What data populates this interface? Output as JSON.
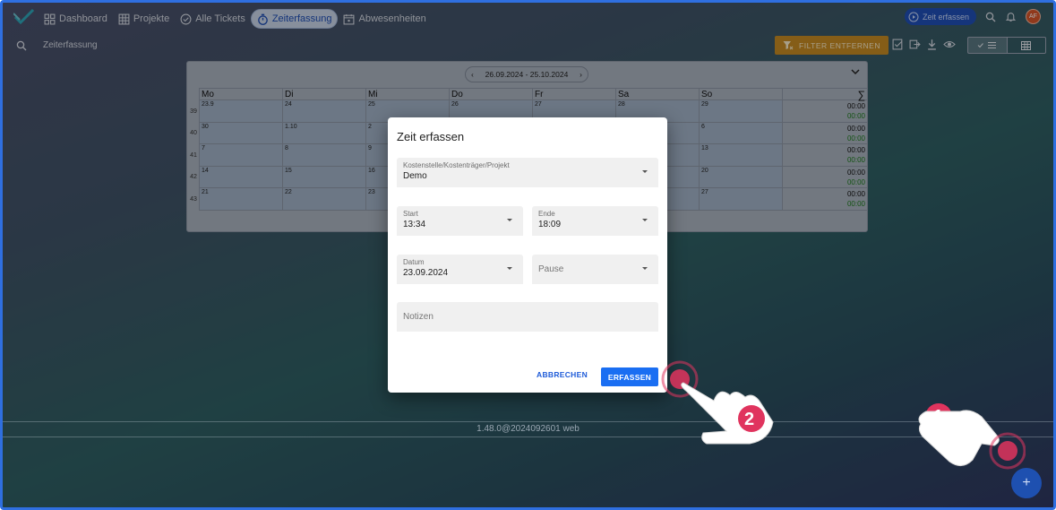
{
  "nav": {
    "items": [
      {
        "label": "Dashboard",
        "icon": "dashboard-icon"
      },
      {
        "label": "Projekte",
        "icon": "grid-icon"
      },
      {
        "label": "Alle Tickets",
        "icon": "check-circle-icon"
      },
      {
        "label": "Zeiterfassung",
        "icon": "stopwatch-icon",
        "active": true
      },
      {
        "label": "Abwesenheiten",
        "icon": "calendar-icon"
      }
    ]
  },
  "topbar": {
    "zeit_button": "Zeit erfassen",
    "avatar": "AF"
  },
  "subbar": {
    "title": "Zeiterfassung",
    "filter_button": "FILTER ENTFERNEN"
  },
  "calendar": {
    "range": "26.09.2024 - 25.10.2024",
    "days": [
      "Mo",
      "Di",
      "Mi",
      "Do",
      "Fr",
      "Sa",
      "So"
    ],
    "sum_symbol": "∑",
    "weeks": [
      {
        "week": "39",
        "dates": [
          "23.9",
          "24",
          "25",
          "26",
          "27",
          "28",
          "29"
        ],
        "sum1": "00:00",
        "sum2": "00:00"
      },
      {
        "week": "40",
        "dates": [
          "30",
          "1.10",
          "2",
          "",
          "",
          "",
          "6"
        ],
        "sum1": "00:00",
        "sum2": "00:00"
      },
      {
        "week": "41",
        "dates": [
          "7",
          "8",
          "9",
          "",
          "",
          "",
          "13"
        ],
        "sum1": "00:00",
        "sum2": "00:00"
      },
      {
        "week": "42",
        "dates": [
          "14",
          "15",
          "16",
          "",
          "",
          "",
          "20"
        ],
        "sum1": "00:00",
        "sum2": "00:00"
      },
      {
        "week": "43",
        "dates": [
          "21",
          "22",
          "23",
          "",
          "",
          "",
          "27"
        ],
        "sum1": "00:00",
        "sum2": "00:00"
      }
    ]
  },
  "footer": {
    "version": "1.48.0@2024092601 web"
  },
  "fab": {
    "label": "+"
  },
  "dialog": {
    "title": "Zeit erfassen",
    "kostenstelle": {
      "label": "Kostenstelle/Kostenträger/Projekt",
      "value": "Demo"
    },
    "start": {
      "label": "Start",
      "value": "13:34"
    },
    "ende": {
      "label": "Ende",
      "value": "18:09"
    },
    "datum": {
      "label": "Datum",
      "value": "23.09.2024"
    },
    "pause": {
      "placeholder": "Pause"
    },
    "notizen": {
      "placeholder": "Notizen"
    },
    "cancel": "ABBRECHEN",
    "submit": "ERFASSEN"
  },
  "annotations": {
    "step1": "1",
    "step2": "2"
  },
  "colors": {
    "accent": "#1a6ef2",
    "filter": "#c58a22",
    "marker": "#e0345e"
  }
}
